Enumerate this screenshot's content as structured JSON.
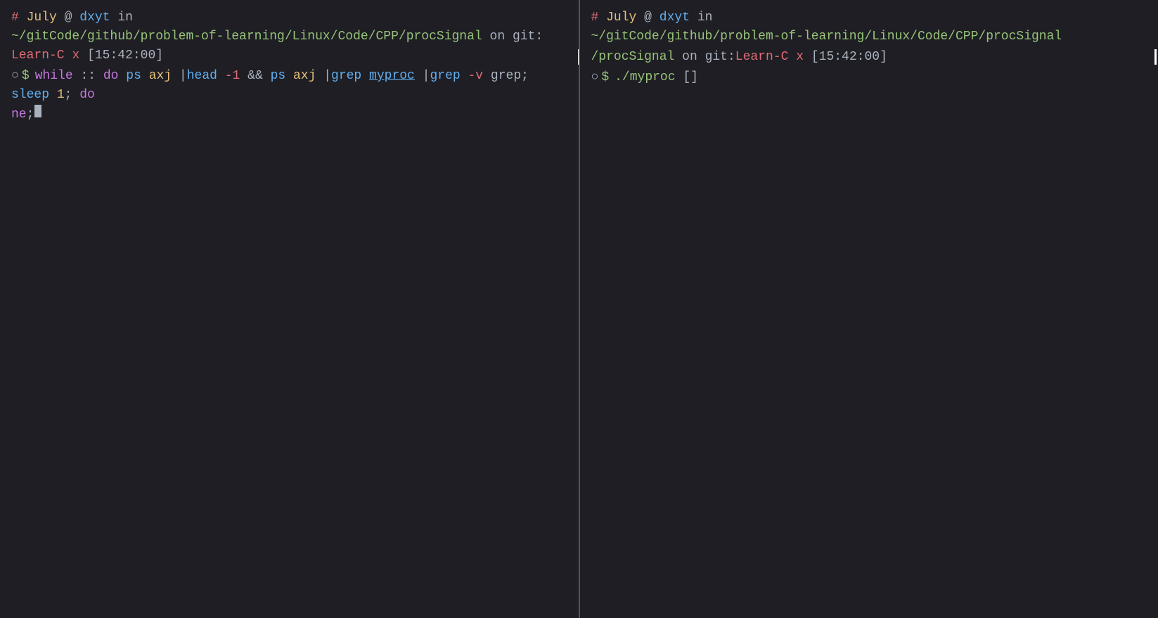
{
  "left_pane": {
    "prompt": {
      "hash": "#",
      "month": "July",
      "at": "@",
      "username": "dxyt",
      "in": "in",
      "path": "~/gitCode/github/problem-of-learning/Linux/Code/CPP/procSignal",
      "on": "on",
      "git_label": "git:",
      "branch": "Learn-C",
      "x": "x",
      "time_bracket_open": "[",
      "time": "15:42:00",
      "time_bracket_close": "]"
    },
    "cmd_line": {
      "circle": "○",
      "dollar": "$",
      "cmd": "while :: do ps axj |head -1 && ps axj |grep myproc |grep -v grep; sleep 1; done;"
    }
  },
  "right_pane": {
    "prompt": {
      "hash": "#",
      "month": "July",
      "at": "@",
      "username": "dxyt",
      "in": "in",
      "path": "~/gitCode/github/problem-of-learning/Linux/Code/CPP/procSignal",
      "on": "on",
      "git_label": "git:",
      "branch": "Learn-C",
      "x": "x",
      "time_bracket_open": "[",
      "time": "15:42:00",
      "time_bracket_close": "]"
    },
    "cmd_line": {
      "circle": "○",
      "dollar": "$",
      "cmd": "./myproc"
    }
  }
}
